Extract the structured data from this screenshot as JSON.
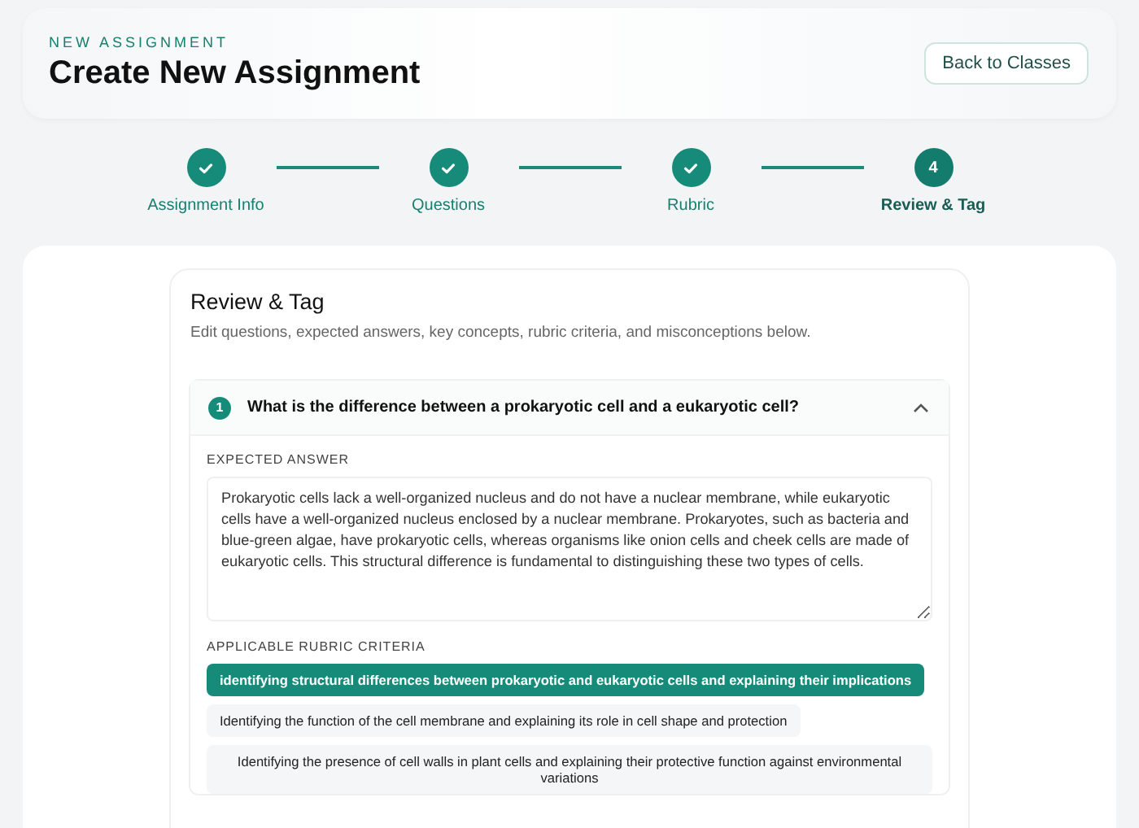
{
  "header": {
    "eyebrow": "NEW ASSIGNMENT",
    "title": "Create New Assignment",
    "back_button": "Back to Classes"
  },
  "steps": [
    {
      "label": "Assignment Info",
      "completed": true,
      "selected": false
    },
    {
      "label": "Questions",
      "completed": true,
      "selected": false
    },
    {
      "label": "Rubric",
      "completed": true,
      "selected": false
    },
    {
      "number": "4",
      "label": "Review & Tag",
      "completed": false,
      "selected": true
    }
  ],
  "review": {
    "title": "Review & Tag",
    "subtitle": "Edit questions, expected answers, key concepts, rubric criteria, and misconceptions below.",
    "questions": [
      {
        "number": "1",
        "text": "What is the difference between a prokaryotic cell and a eukaryotic cell?",
        "expanded": true,
        "expected_answer_label": "EXPECTED ANSWER",
        "expected_answer": "Prokaryotic cells lack a well-organized nucleus and do not have a nuclear membrane, while eukaryotic cells have a well-organized nucleus enclosed by a nuclear membrane. Prokaryotes, such as bacteria and blue-green algae, have prokaryotic cells, whereas organisms like onion cells and cheek cells are made of eukaryotic cells. This structural difference is fundamental to distinguishing these two types of cells.",
        "criteria_label": "APPLICABLE RUBRIC CRITERIA",
        "criteria": [
          {
            "text": "identifying structural differences between prokaryotic and eukaryotic cells and explaining their implications",
            "selected": true
          },
          {
            "text": "Identifying the function of the cell membrane and explaining its role in cell shape and protection",
            "selected": false
          },
          {
            "text": "Identifying the presence of cell walls in plant cells and explaining their protective function against environmental variations",
            "selected": false
          }
        ]
      }
    ]
  }
}
